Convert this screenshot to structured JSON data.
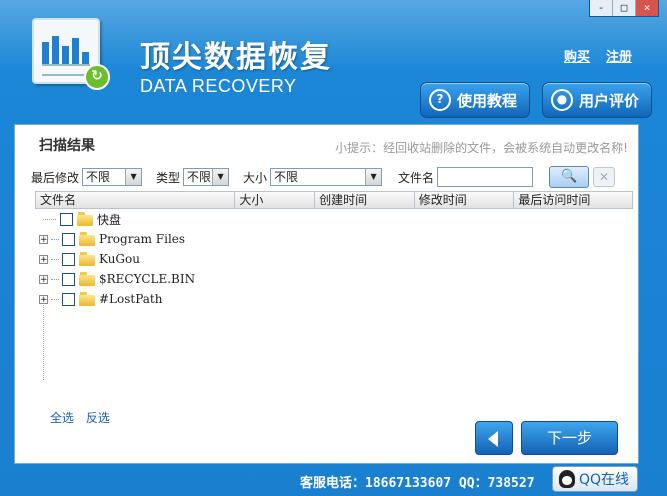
{
  "window": {
    "controls": {
      "minimize": "-",
      "maximize": "□",
      "close": "×"
    }
  },
  "header": {
    "title_cn": "顶尖数据恢复",
    "title_en": "DATA RECOVERY",
    "links": {
      "buy": "购买",
      "register": "注册"
    },
    "buttons": {
      "tutorial": {
        "label": "使用教程",
        "icon": "question-icon"
      },
      "review": {
        "label": "用户评价",
        "icon": "user-icon"
      }
    }
  },
  "panel": {
    "title": "扫描结果",
    "tip": "小提示：经回收站删除的文件，会被系统自动更改名称!",
    "filters": {
      "modified_label": "最后修改",
      "modified_value": "不限",
      "type_label": "类型",
      "type_value": "不限",
      "size_label": "大小",
      "size_value": "不限",
      "filename_label": "文件名",
      "filename_value": "",
      "search_icon": "search-icon",
      "clear_icon": "close-icon"
    },
    "columns": [
      "文件名",
      "大小",
      "创建时间",
      "修改时间",
      "最后访问时间"
    ],
    "tree": [
      {
        "name": "快盘",
        "expandable": false
      },
      {
        "name": "Program Files",
        "expandable": true
      },
      {
        "name": "KuGou",
        "expandable": true
      },
      {
        "name": "$RECYCLE.BIN",
        "expandable": true
      },
      {
        "name": "#LostPath",
        "expandable": true
      }
    ],
    "select_all": "全选",
    "invert_select": "反选"
  },
  "nav": {
    "back_icon": "back-arrow-icon",
    "next_label": "下一步"
  },
  "footer": {
    "contact": "客服电话：18667133607 QQ：738527",
    "qq_label": "QQ在线"
  },
  "colors": {
    "window_bg": "#1b86d6",
    "accent": "#1560b6",
    "panel_bg": "#ffffff"
  }
}
